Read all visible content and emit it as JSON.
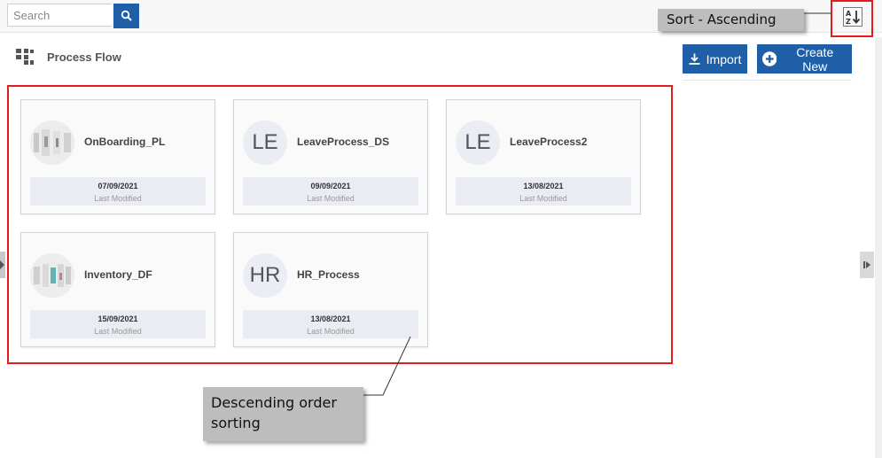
{
  "search": {
    "placeholder": "Search",
    "value": ""
  },
  "header": {
    "title": "Process Flow",
    "sort_tooltip": "Sort - Ascending"
  },
  "actions": {
    "import_label": "Import",
    "create_label": "Create New"
  },
  "cards": [
    {
      "name": "OnBoarding_PL",
      "avatar": "",
      "avatar_type": "image",
      "date": "07/09/2021",
      "meta": "Last Modified"
    },
    {
      "name": "LeaveProcess_DS",
      "avatar": "LE",
      "avatar_type": "initials",
      "date": "09/09/2021",
      "meta": "Last Modified"
    },
    {
      "name": "LeaveProcess2",
      "avatar": "LE",
      "avatar_type": "initials",
      "date": "13/08/2021",
      "meta": "Last Modified"
    },
    {
      "name": "Inventory_DF",
      "avatar": "",
      "avatar_type": "image",
      "date": "15/09/2021",
      "meta": "Last Modified"
    },
    {
      "name": "HR_Process",
      "avatar": "HR",
      "avatar_type": "initials",
      "date": "13/08/2021",
      "meta": "Last Modified"
    }
  ],
  "annotations": {
    "descending_note": "Descending order sorting"
  },
  "colors": {
    "primary": "#1f5fa7",
    "highlight": "#e31b1b",
    "callout": "#bdbdbd"
  },
  "icons": {
    "search": "search-icon",
    "sort": "sort-az-icon",
    "process_flow": "process-flow-icon",
    "import": "download-icon",
    "create": "plus-circle-icon"
  }
}
